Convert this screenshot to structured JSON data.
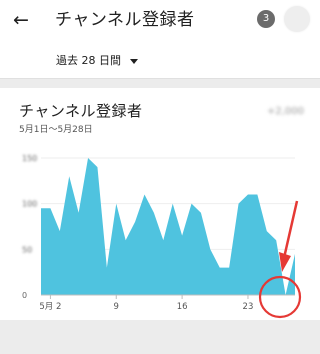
{
  "appbar": {
    "back_icon": "arrow-left-icon",
    "title": "チャンネル登録者",
    "badge": "3",
    "avatar_icon": "avatar"
  },
  "filter": {
    "range_label": "過去 28 日間",
    "caret_icon": "caret-down-icon"
  },
  "card": {
    "title": "チャンネル登録者",
    "subtitle": "5月1日〜5月28日",
    "total": "+2,000"
  },
  "chart_data": {
    "type": "area",
    "color": "#4fc3df",
    "x_tick_labels": [
      "5月 2",
      "9",
      "16",
      "23"
    ],
    "x_tick_days": [
      2,
      9,
      16,
      23
    ],
    "y_tick_labels": [
      "0",
      "50",
      "100",
      "150"
    ],
    "ylim": [
      0,
      150
    ],
    "x": [
      1,
      2,
      3,
      4,
      5,
      6,
      7,
      8,
      9,
      10,
      11,
      12,
      13,
      14,
      15,
      16,
      17,
      18,
      19,
      20,
      21,
      22,
      23,
      24,
      25,
      26,
      27,
      28
    ],
    "values": [
      95,
      95,
      70,
      130,
      90,
      150,
      140,
      30,
      100,
      60,
      80,
      110,
      90,
      60,
      100,
      65,
      100,
      90,
      50,
      30,
      30,
      100,
      110,
      110,
      70,
      60,
      0,
      45
    ],
    "grid": true
  },
  "annotation": {
    "arrow_color": "#e53935",
    "circle_color": "#e53935"
  }
}
